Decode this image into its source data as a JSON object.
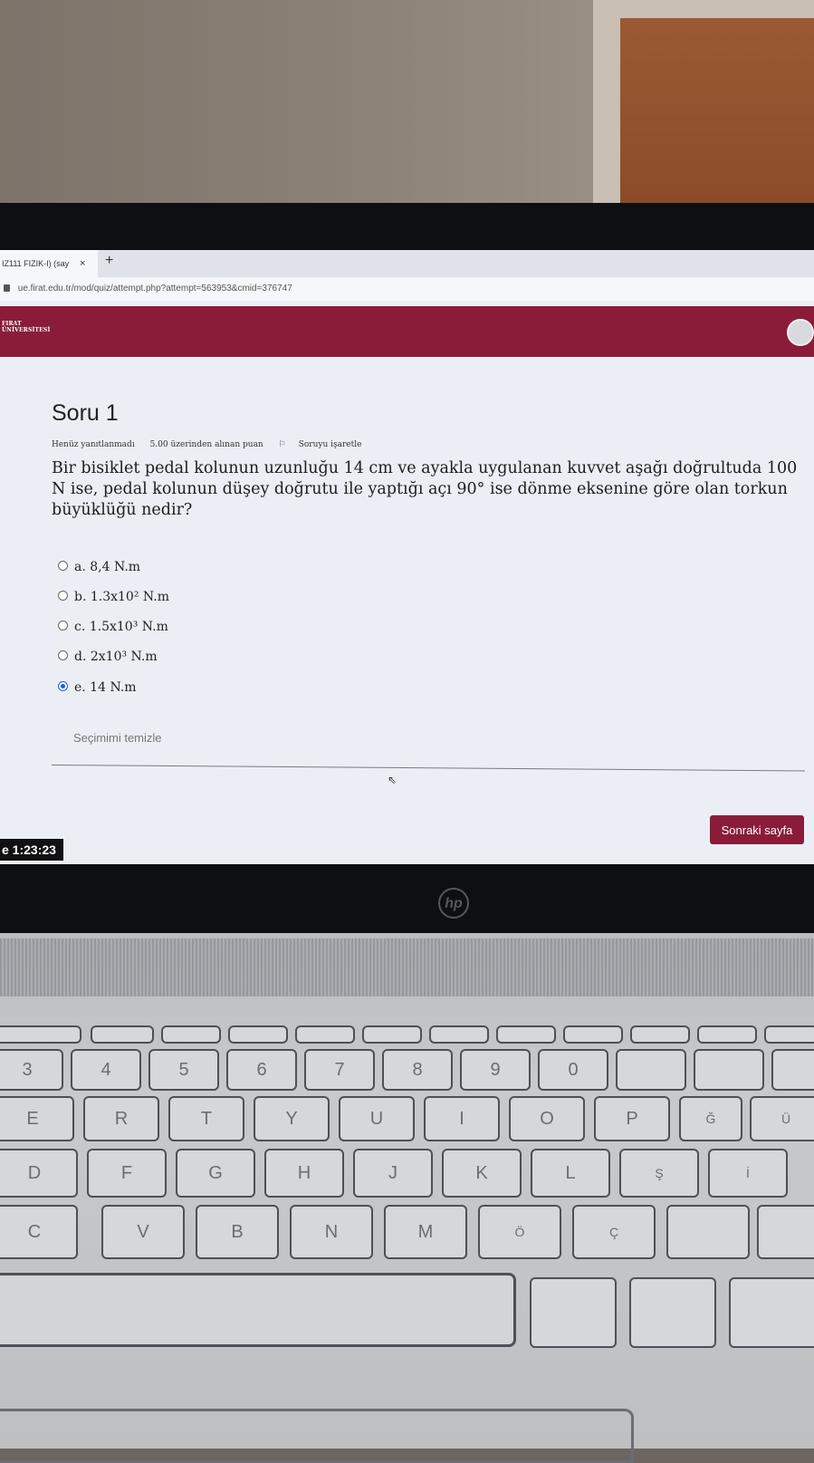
{
  "browser": {
    "tab_title": "IZ111 FIZIK-I) (say",
    "tab_close": "×",
    "new_tab": "+",
    "url": "ue.firat.edu.tr/mod/quiz/attempt.php?attempt=563953&cmid=376747"
  },
  "site": {
    "logo_line1": "FIRAT",
    "logo_line2": "ÜNİVERSİTESİ"
  },
  "question": {
    "title": "Soru 1",
    "status": "Henüz yanıtlanmadı",
    "points": "5.00 üzerinden alınan puan",
    "flag_label": "Soruyu işaretle",
    "text": "Bir bisiklet pedal kolunun uzunluğu 14 cm ve ayakla uygulanan kuvvet aşağı doğrultuda 100 N ise, pedal kolunun düşey doğrutu ile yaptığı açı 90° ise dönme eksenine göre olan torkun büyüklüğü nedir?",
    "options": [
      {
        "label": "a. 8,4 N.m",
        "selected": false
      },
      {
        "label": "b. 1.3x10² N.m",
        "selected": false
      },
      {
        "label": "c. 1.5x10³ N.m",
        "selected": false
      },
      {
        "label": "d. 2x10³ N.m",
        "selected": false
      },
      {
        "label": "e. 14 N.m",
        "selected": true
      }
    ],
    "clear_label": "Seçimimi temizle",
    "next_label": "Sonraki sayfa"
  },
  "timer": "e 1:23:23",
  "laptop": {
    "brand": "hp",
    "row_keys_1": [
      "3",
      "4",
      "5",
      "6",
      "7",
      "8",
      "9",
      "0"
    ],
    "row_keys_2": [
      "E",
      "R",
      "T",
      "Y",
      "U",
      "I",
      "O",
      "P",
      "Ğ",
      "Ü"
    ],
    "row_keys_3": [
      "D",
      "F",
      "G",
      "H",
      "J",
      "K",
      "L",
      "Ş",
      "İ"
    ],
    "row_keys_4": [
      "C",
      "V",
      "B",
      "N",
      "M",
      "Ö",
      "Ç"
    ]
  }
}
